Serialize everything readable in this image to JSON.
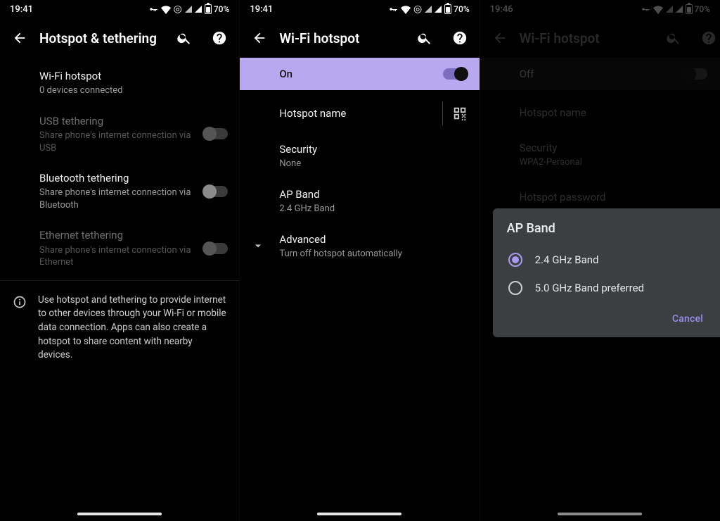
{
  "status": {
    "time_a": "19:41",
    "time_b": "19:41",
    "time_c": "19:46",
    "battery": "70%"
  },
  "p1": {
    "title": "Hotspot & tethering",
    "wifi_hotspot": {
      "title": "Wi-Fi hotspot",
      "sub": "0 devices connected"
    },
    "usb": {
      "title": "USB tethering",
      "sub": "Share phone's internet connection via USB"
    },
    "bt": {
      "title": "Bluetooth tethering",
      "sub": "Share phone's internet connection via Bluetooth"
    },
    "eth": {
      "title": "Ethernet tethering",
      "sub": "Share phone's internet connection via Ethernet"
    },
    "footer": "Use hotspot and tethering to provide internet to other devices through your Wi-Fi or mobile data connection. Apps can also create a hotspot to share content with nearby devices."
  },
  "p2": {
    "title": "Wi-Fi hotspot",
    "on_label": "On",
    "hotspot_name": {
      "title": "Hotspot name"
    },
    "security": {
      "title": "Security",
      "value": "None"
    },
    "apband": {
      "title": "AP Band",
      "value": "2.4 GHz Band"
    },
    "advanced": {
      "title": "Advanced",
      "sub": "Turn off hotspot automatically"
    }
  },
  "p3": {
    "title": "Wi-Fi hotspot",
    "off_label": "Off",
    "hotspot_name": {
      "title": "Hotspot name"
    },
    "security": {
      "title": "Security",
      "value": "WPA2-Personal"
    },
    "hotspot_pwd": {
      "title": "Hotspot password"
    },
    "dialog": {
      "title": "AP Band",
      "opt1": "2.4 GHz Band",
      "opt2": "5.0 GHz Band preferred",
      "cancel": "Cancel"
    }
  }
}
